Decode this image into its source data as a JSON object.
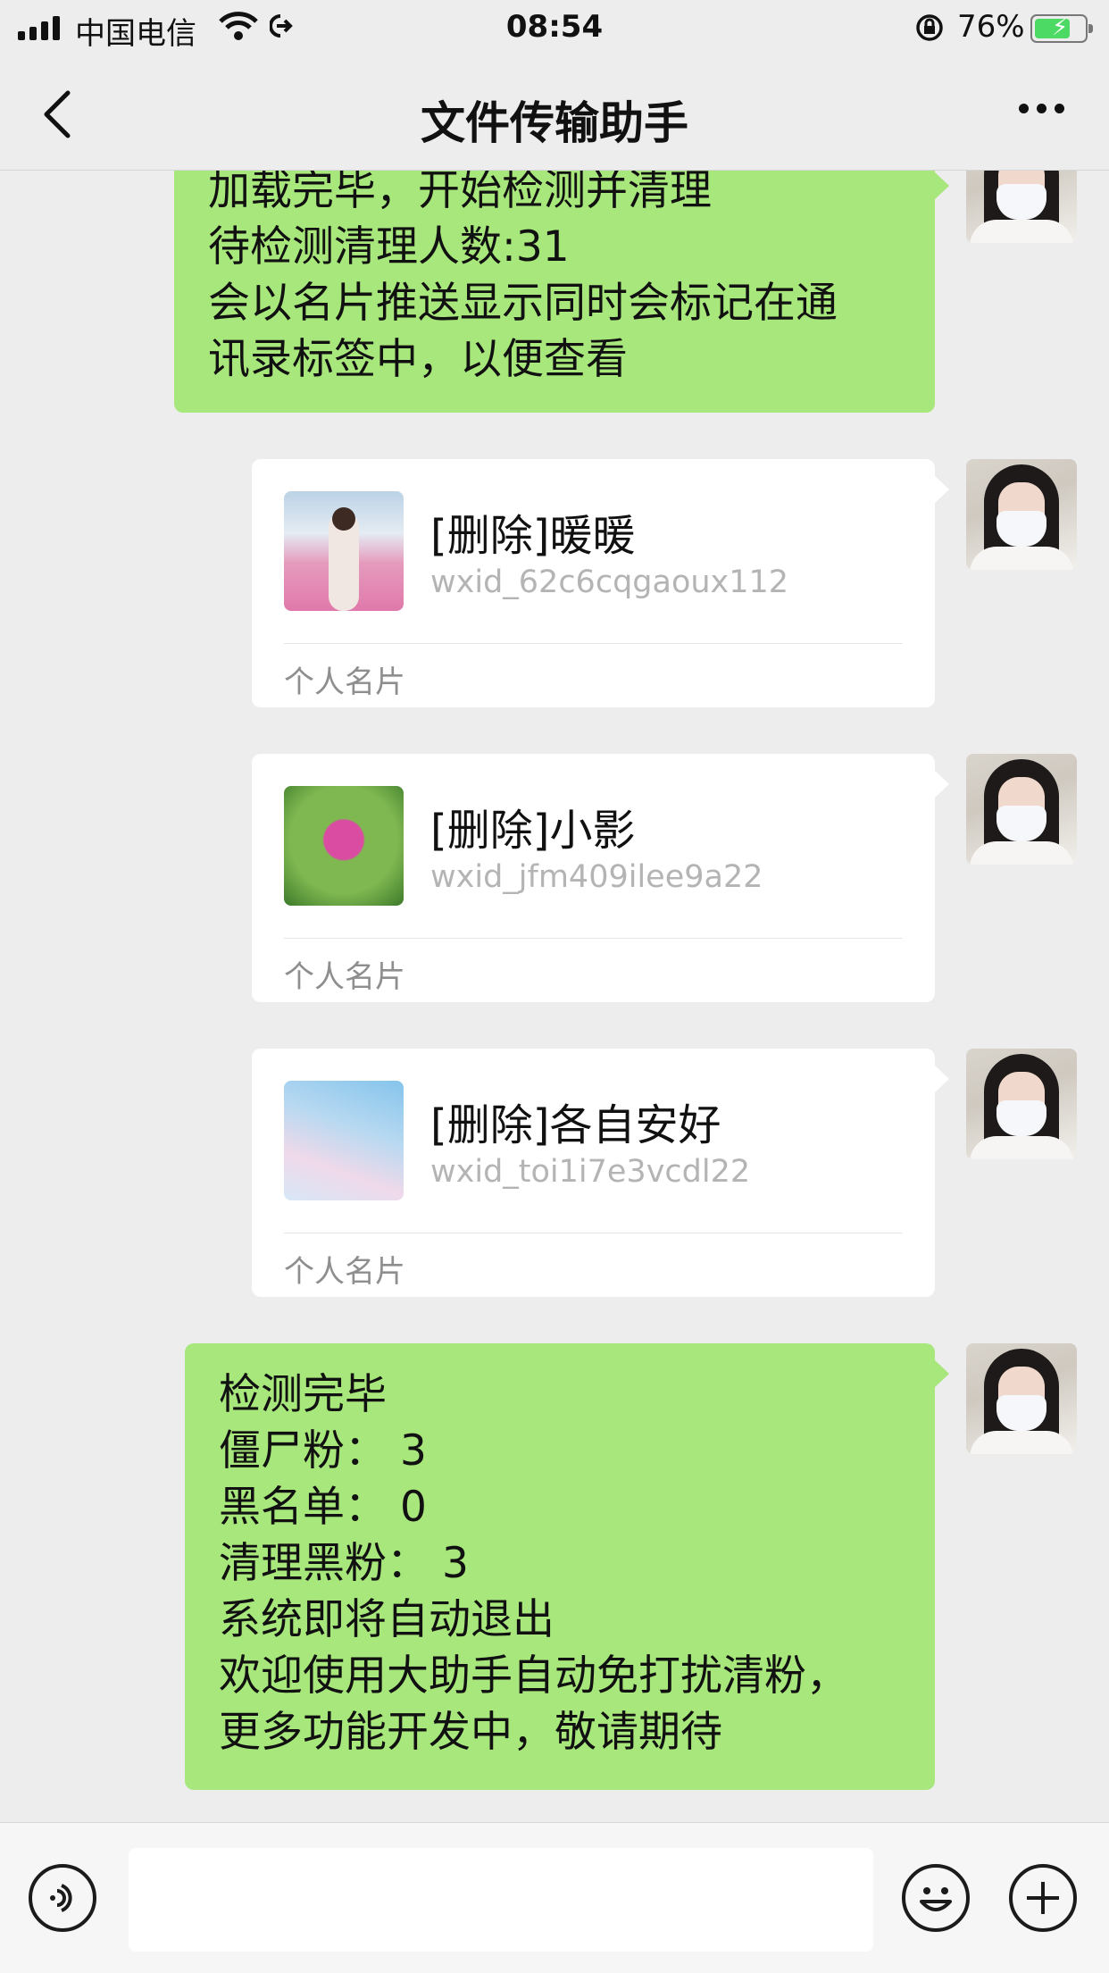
{
  "status_bar": {
    "carrier": "中国电信",
    "time": "08:54",
    "battery_percent": "76%"
  },
  "header": {
    "title": "文件传输助手"
  },
  "messages": {
    "m1": {
      "lines": [
        "加载完毕，开始检测并清理",
        "待检测清理人数:31",
        "会以名片推送显示同时会标记在通",
        "讯录标签中，以便查看"
      ]
    },
    "cards": [
      {
        "name": "[删除]暖暖",
        "wxid": "wxid_62c6cqgaoux112",
        "type": "个人名片"
      },
      {
        "name": "[删除]小影",
        "wxid": "wxid_jfm409ilee9a22",
        "type": "个人名片"
      },
      {
        "name": "[删除]各自安好",
        "wxid": "wxid_toi1i7e3vcdl22",
        "type": "个人名片"
      }
    ],
    "m2": {
      "lines": [
        "检测完毕",
        "僵尸粉：  3",
        "黑名单：  0",
        "清理黑粉：  3",
        "系统即将自动退出",
        "欢迎使用大助手自动免打扰清粉，",
        "更多功能开发中，敬请期待"
      ]
    }
  },
  "icons": {
    "back": "chevron-left-icon",
    "more": "more-icon",
    "voice": "voice-icon",
    "emoji": "emoji-icon",
    "plus": "plus-icon"
  },
  "colors": {
    "own_bubble": "#a8e77c",
    "background": "#ededed",
    "card": "#ffffff"
  }
}
